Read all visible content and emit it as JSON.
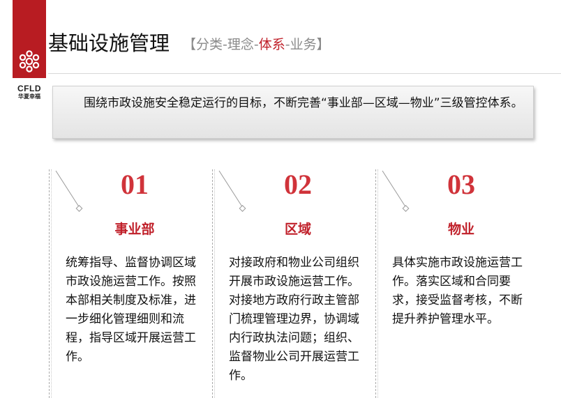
{
  "logo": {
    "brand": "CFLD",
    "sub": "华夏幸福"
  },
  "header": {
    "title": "基础设施管理",
    "bracket_open": "【",
    "crumb_1": "分类",
    "sep_1": "-",
    "crumb_2": "理念",
    "sep_2": "-",
    "crumb_3": "体系",
    "sep_3": "-",
    "crumb_4": "业务",
    "bracket_close": "】"
  },
  "banner": {
    "text": "围绕市政设施安全稳定运行的目标，不断完善“事业部—区域—物业”三级管控体系。"
  },
  "columns": [
    {
      "number": "01",
      "title": "事业部",
      "body": "统筹指导、监督协调区域市政设施运营工作。按照本部相关制度及标准，进一步细化管理细则和流程，指导区域开展运营工作。"
    },
    {
      "number": "02",
      "title": "区域",
      "body": "对接政府和物业公司组织开展市政设施运营工作。对接地方政府行政主管部门梳理管理边界，协调域内行政执法问题；组织、监督物业公司开展运营工作。"
    },
    {
      "number": "03",
      "title": "物业",
      "body": "具体实施市政设施运营工作。落实区域和合同要求，接受监督考核，不断提升养护管理水平。"
    }
  ],
  "colors": {
    "brand_red": "#b81c22",
    "accent_red": "#c0202a",
    "number_red": "#d0333a",
    "muted_gray": "#8a8a8a"
  }
}
